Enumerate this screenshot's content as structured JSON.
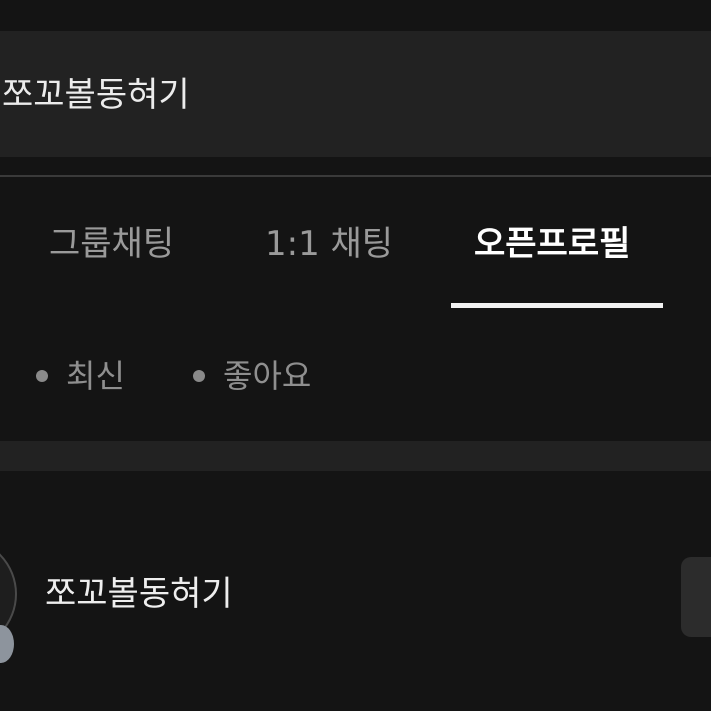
{
  "search": {
    "query": "쪼꼬볼동혀기"
  },
  "tabs": [
    {
      "label": "그룹채팅"
    },
    {
      "label": "1:1 채팅"
    },
    {
      "label": "오픈프로필"
    }
  ],
  "active_tab": "오픈프로필",
  "sort_options": [
    {
      "label": "최신"
    },
    {
      "label": "좋아요"
    }
  ],
  "results": [
    {
      "name": "쪼꼬볼동혀기"
    }
  ],
  "colors": {
    "background": "#141414",
    "surface": "#222222",
    "active_text": "#ffffff",
    "inactive_text": "#9a9a9a"
  }
}
